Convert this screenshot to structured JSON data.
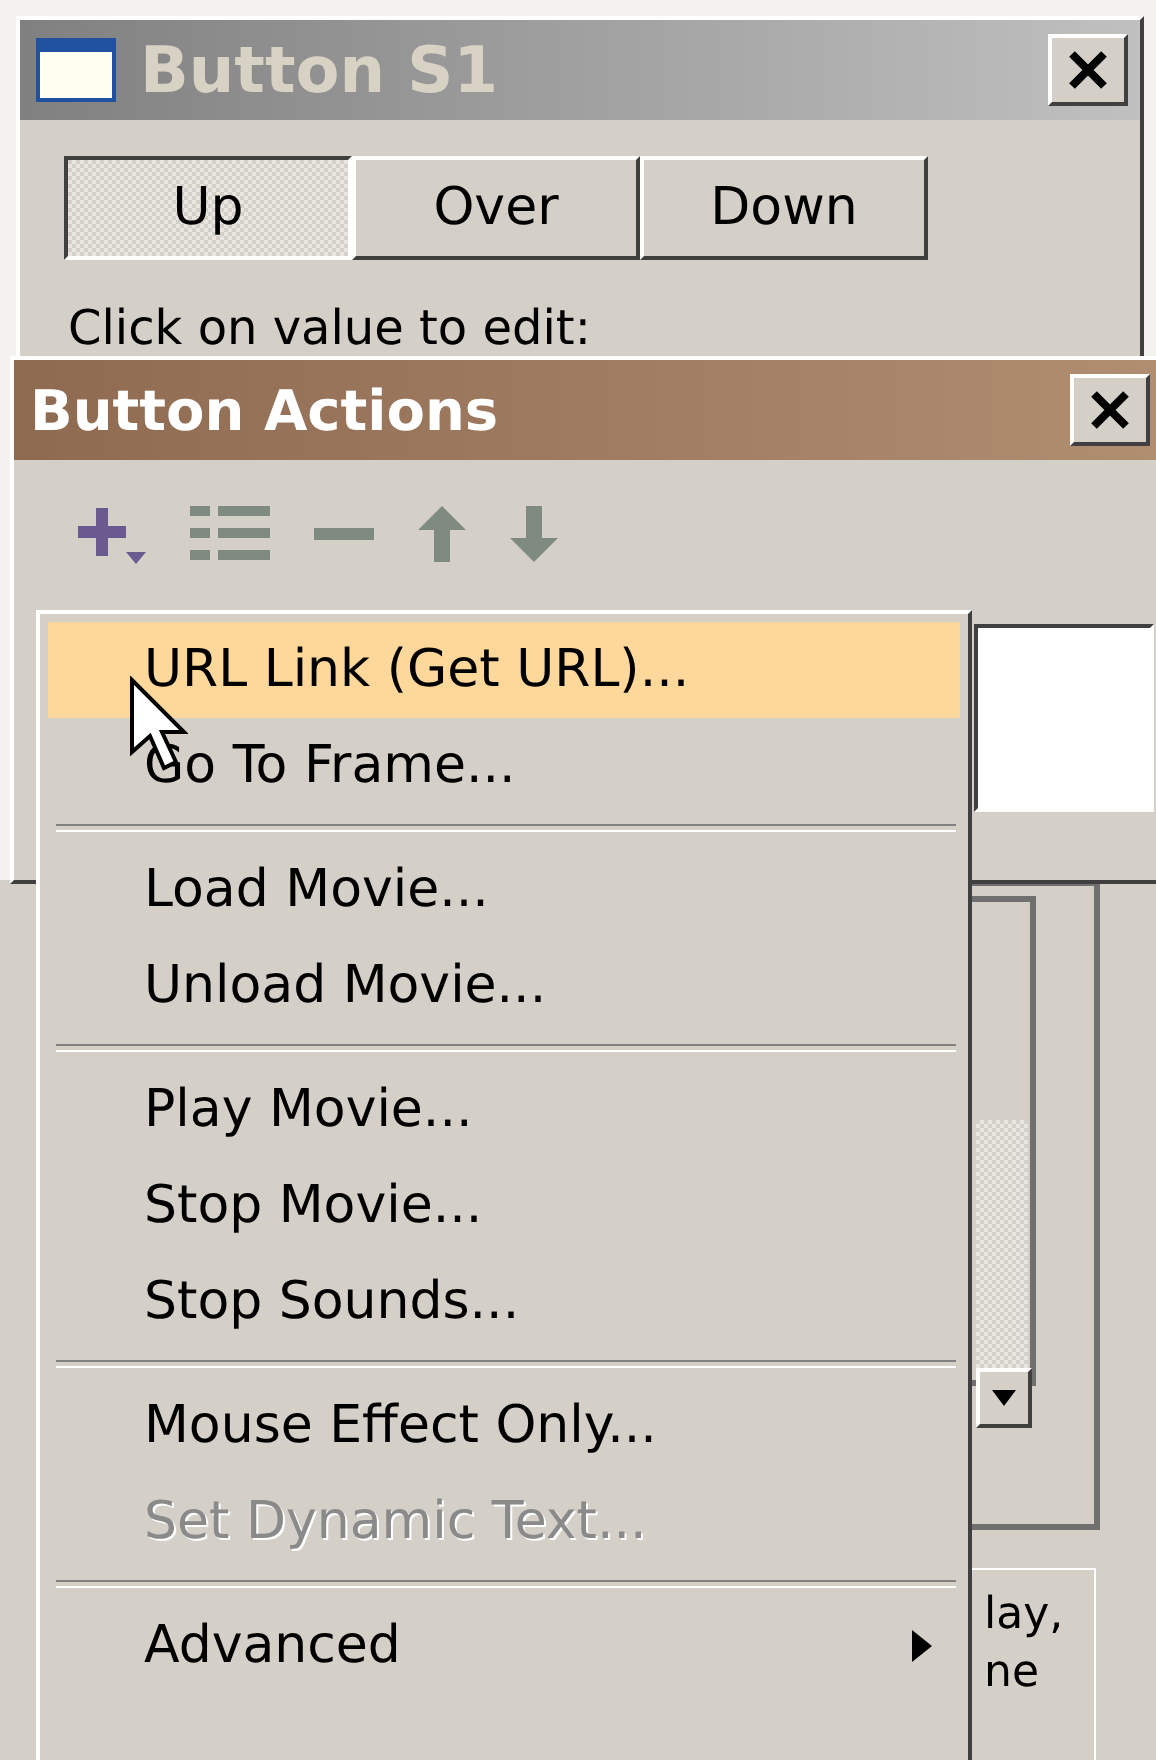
{
  "states_window": {
    "title": "Button S1",
    "tabs": [
      {
        "label": "Up",
        "selected": true
      },
      {
        "label": "Over",
        "selected": false
      },
      {
        "label": "Down",
        "selected": false
      }
    ],
    "hint": "Click on value to edit:"
  },
  "actions_window": {
    "title": "Button Actions"
  },
  "menu": {
    "items": [
      {
        "kind": "item",
        "label": "URL Link (Get URL)...",
        "selected": true,
        "disabled": false
      },
      {
        "kind": "item",
        "label": "Go To Frame...",
        "selected": false,
        "disabled": false
      },
      {
        "kind": "separator"
      },
      {
        "kind": "item",
        "label": "Load Movie...",
        "selected": false,
        "disabled": false
      },
      {
        "kind": "item",
        "label": "Unload Movie...",
        "selected": false,
        "disabled": false
      },
      {
        "kind": "separator"
      },
      {
        "kind": "item",
        "label": "Play Movie...",
        "selected": false,
        "disabled": false
      },
      {
        "kind": "item",
        "label": "Stop Movie...",
        "selected": false,
        "disabled": false
      },
      {
        "kind": "item",
        "label": "Stop Sounds...",
        "selected": false,
        "disabled": false
      },
      {
        "kind": "separator"
      },
      {
        "kind": "item",
        "label": "Mouse Effect Only...",
        "selected": false,
        "disabled": false
      },
      {
        "kind": "item",
        "label": "Set Dynamic Text...",
        "selected": false,
        "disabled": true
      },
      {
        "kind": "separator"
      },
      {
        "kind": "submenu",
        "label": "Advanced",
        "selected": false,
        "disabled": false
      }
    ]
  },
  "background_panel": {
    "text_fragments": [
      "lay,",
      "ne"
    ]
  }
}
